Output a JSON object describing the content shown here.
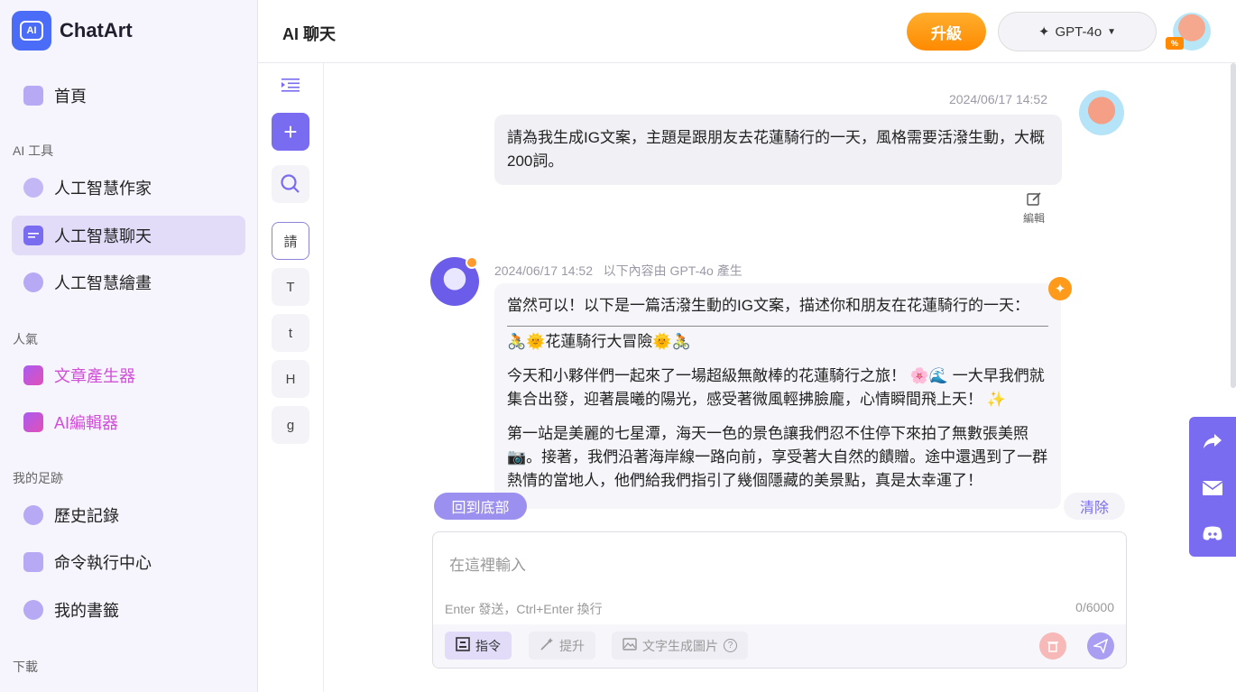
{
  "app": {
    "name": "ChatArt",
    "logo_mark": "AI"
  },
  "sidebar": {
    "home": "首頁",
    "sections": {
      "ai_tools": "AI 工具",
      "popular": "人氣",
      "footprint": "我的足跡",
      "download": "下載"
    },
    "items": {
      "writer": "人工智慧作家",
      "chat": "人工智慧聊天",
      "draw": "人工智慧繪畫",
      "article": "文章產生器",
      "ai_editor": "AI編輯器",
      "history": "歷史記錄",
      "command": "命令執行中心",
      "bookmarks": "我的書籤"
    }
  },
  "header": {
    "title": "AI 聊天",
    "upgrade": "升級",
    "model": "GPT-4o",
    "badge": "%"
  },
  "tools": {
    "plus": "+",
    "prompt_char": "請",
    "letters": [
      "T",
      "t",
      "H",
      "g"
    ]
  },
  "chat": {
    "user_msg": {
      "timestamp": "2024/06/17 14:52",
      "text": "請為我生成IG文案，主題是跟朋友去花蓮騎行的一天，風格需要活潑生動，大概200詞。",
      "edit_label": "編輯"
    },
    "bot_msg": {
      "timestamp": "2024/06/17 14:52",
      "source": "以下內容由 GPT-4o 產生",
      "intro": "當然可以！以下是一篇活潑生動的IG文案，描述你和朋友在花蓮騎行的一天：",
      "heading": "🚴🌞花蓮騎行大冒險🌞🚴",
      "p1": "今天和小夥伴們一起來了一場超級無敵棒的花蓮騎行之旅！ 🌸🌊 一大早我們就集合出發，迎著晨曦的陽光，感受著微風輕拂臉龐，心情瞬間飛上天！ ✨",
      "p2": "第一站是美麗的七星潭，海天一色的景色讓我們忍不住停下來拍了無數張美照📷。接著，我們沿著海岸線一路向前，享受著大自然的饋贈。途中還遇到了一群熱情的當地人，他們給我們指引了幾個隱藏的美景點，真是太幸運了！"
    },
    "back_to_bottom": "回到底部",
    "clear": "清除"
  },
  "input": {
    "placeholder": "在這裡輸入",
    "hint": "Enter 發送，Ctrl+Enter 換行",
    "count": "0/6000",
    "buttons": {
      "command": "指令",
      "enhance": "提升",
      "text_to_image": "文字生成圖片"
    }
  },
  "colors": {
    "accent": "#7a6cf0",
    "upgrade": "#ff8a00",
    "active_bg": "#e2dcf9"
  }
}
